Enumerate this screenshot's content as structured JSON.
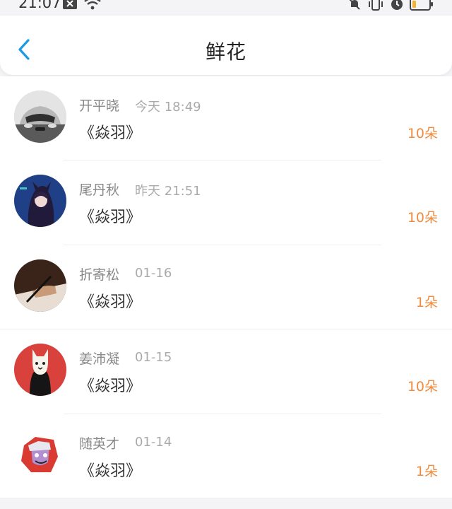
{
  "status": {
    "time": "21:07",
    "left_icons": [
      "notification-x-icon",
      "wifi-icon"
    ],
    "right_icons": [
      "bell-mute-icon",
      "vibrate-icon",
      "alarm-icon",
      "battery-icon"
    ]
  },
  "header": {
    "title": "鲜花",
    "back_icon": "chevron-left-icon",
    "accent_color": "#1a9be6"
  },
  "colors": {
    "count": "#f08a3c",
    "name": "#888888"
  },
  "items": [
    {
      "name": "开平晓",
      "time": "今天 18:49",
      "book": "《焱羽》",
      "count": "10朵"
    },
    {
      "name": "尾丹秋",
      "time": "昨天 21:51",
      "book": "《焱羽》",
      "count": "10朵"
    },
    {
      "name": "折寄松",
      "time": "01-16",
      "book": "《焱羽》",
      "count": "1朵"
    },
    {
      "name": "姜沛凝",
      "time": "01-15",
      "book": "《焱羽》",
      "count": "10朵"
    },
    {
      "name": "随英才",
      "time": "01-14",
      "book": "《焱羽》",
      "count": "1朵"
    }
  ]
}
